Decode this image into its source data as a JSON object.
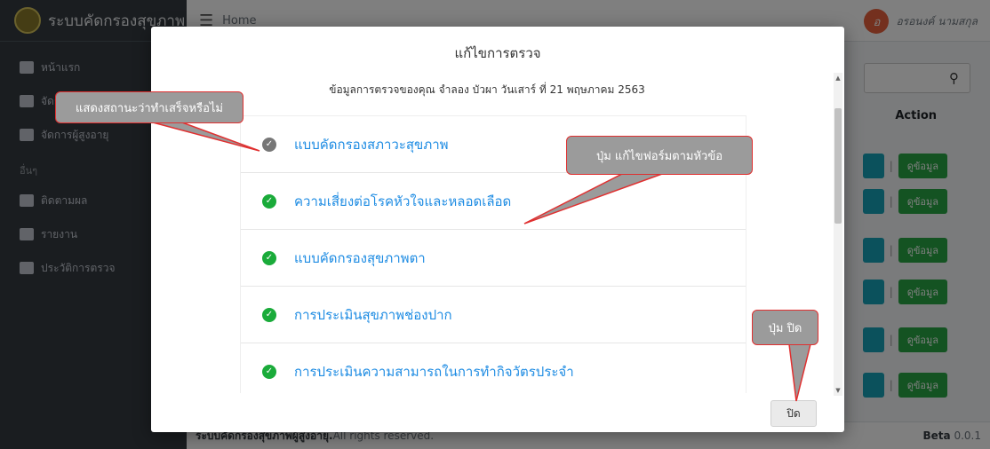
{
  "sidebar": {
    "brand": "ระบบคัดกรองสุขภาพ",
    "items": [
      {
        "label": "หน้าแรก"
      },
      {
        "label": "จัดการข้อมูล"
      },
      {
        "label": "จัดการผู้สูงอายุ"
      }
    ],
    "section_header": "อื่นๆ",
    "items2": [
      {
        "label": "ติดตามผล"
      },
      {
        "label": "รายงาน"
      },
      {
        "label": "ประวัติการตรวจ"
      }
    ]
  },
  "topbar": {
    "breadcrumb": "Home",
    "user_initial": "อ",
    "user_name": "อรอนงค์ นามสกุล"
  },
  "table": {
    "action_header": "Action",
    "view_label": "ดูข้อมูล",
    "separator": "|"
  },
  "footer": {
    "brand": "ระบบคัดกรองสุขภาพผู้สูงอายุ.",
    "rights": "All rights reserved.",
    "beta_label": "Beta",
    "version": "0.0.1"
  },
  "modal": {
    "title": "แก้ไขการตรวจ",
    "subtitle": "ข้อมูลการตรวจของคุณ จำลอง บัวผา วันเสาร์ ที่ 21 พฤษภาคม 2563",
    "items": [
      {
        "label": "แบบคัดกรองสภาวะสุขภาพ",
        "status": "pending"
      },
      {
        "label": "ความเสี่ยงต่อโรคหัวใจและหลอดเลือด",
        "status": "done"
      },
      {
        "label": "แบบคัดกรองสุขภาพตา",
        "status": "done"
      },
      {
        "label": "การประเมินสุขภาพช่องปาก",
        "status": "done"
      },
      {
        "label": "การประเมินความสามารถในการทำกิจวัตรประจำ",
        "status": "done"
      }
    ],
    "close_label": "ปิด"
  },
  "annotations": {
    "status_note": "แสดงสถานะว่าทำเสร็จหรือไม่",
    "edit_note": "ปุ่ม แก้ไขฟอร์มตามหัวข้อ",
    "close_note": "ปุ่ม ปิด"
  },
  "colors": {
    "accent_link": "#1e8ce3",
    "done": "#1aab3a",
    "pending": "#777777",
    "view_button": "#28a745",
    "callout_border": "#e03030"
  }
}
